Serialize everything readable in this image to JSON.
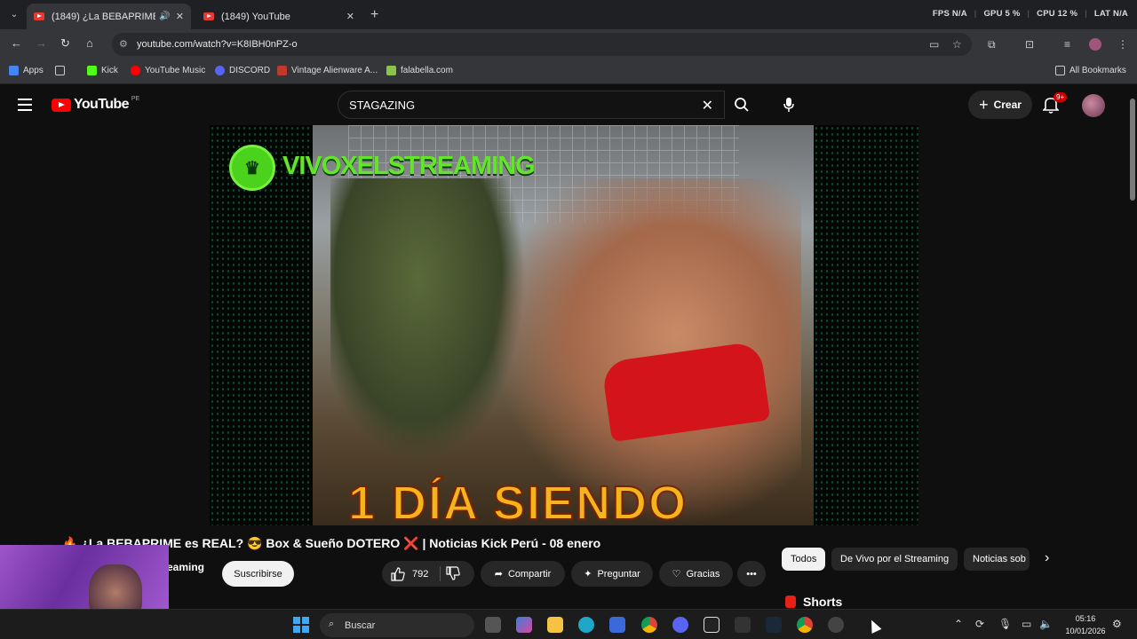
{
  "browser": {
    "tabs": [
      {
        "title": "(1849) ¿La BEBAPRIME e",
        "active": true
      },
      {
        "title": "(1849) YouTube",
        "active": false
      }
    ],
    "stats": {
      "fps_label": "FPS",
      "fps_value": "N/A",
      "gpu_label": "GPU",
      "gpu_value": "5 %",
      "cpu_label": "CPU",
      "cpu_value": "12 %",
      "lat_label": "LAT",
      "lat_value": "N/A"
    },
    "url": "youtube.com/watch?v=K8IBH0nPZ-o",
    "bookmarks": [
      {
        "label": "Apps",
        "color": "#4285f4"
      },
      {
        "label": "Kick",
        "color": "#53fc18"
      },
      {
        "label": "YouTube Music",
        "color": "#ff0000"
      },
      {
        "label": "DISCORD",
        "color": "#5865f2"
      },
      {
        "label": "Vintage Alienware A...",
        "color": "#c0392b"
      },
      {
        "label": "falabella.com",
        "color": "#8bc34a"
      }
    ],
    "all_bookmarks": "All Bookmarks"
  },
  "youtube": {
    "logo_text": "YouTube",
    "country": "PE",
    "search_value": "STAGAZING",
    "create_label": "Crear",
    "notif_badge": "9+",
    "video": {
      "channel_overlay": "VIVOXELSTREAMING",
      "overlay_text": "1 DÍA SIENDO",
      "title": "🔥 ¿La BEBAPRIME es REAL? 😎 Box & Sueño DOTERO ❌ | Noticias Kick Perú - 08 enero",
      "channel": "eaming",
      "subscribe": "Suscribirse",
      "likes": "792",
      "share": "Compartir",
      "ask": "Preguntar",
      "thanks": "Gracias"
    },
    "chips": [
      "Todos",
      "De Vivo por el Streaming",
      "Noticias sob"
    ],
    "shorts_label": "Shorts"
  },
  "taskbar": {
    "search_placeholder": "Buscar",
    "time": "05:16",
    "date": "10/01/2026"
  }
}
